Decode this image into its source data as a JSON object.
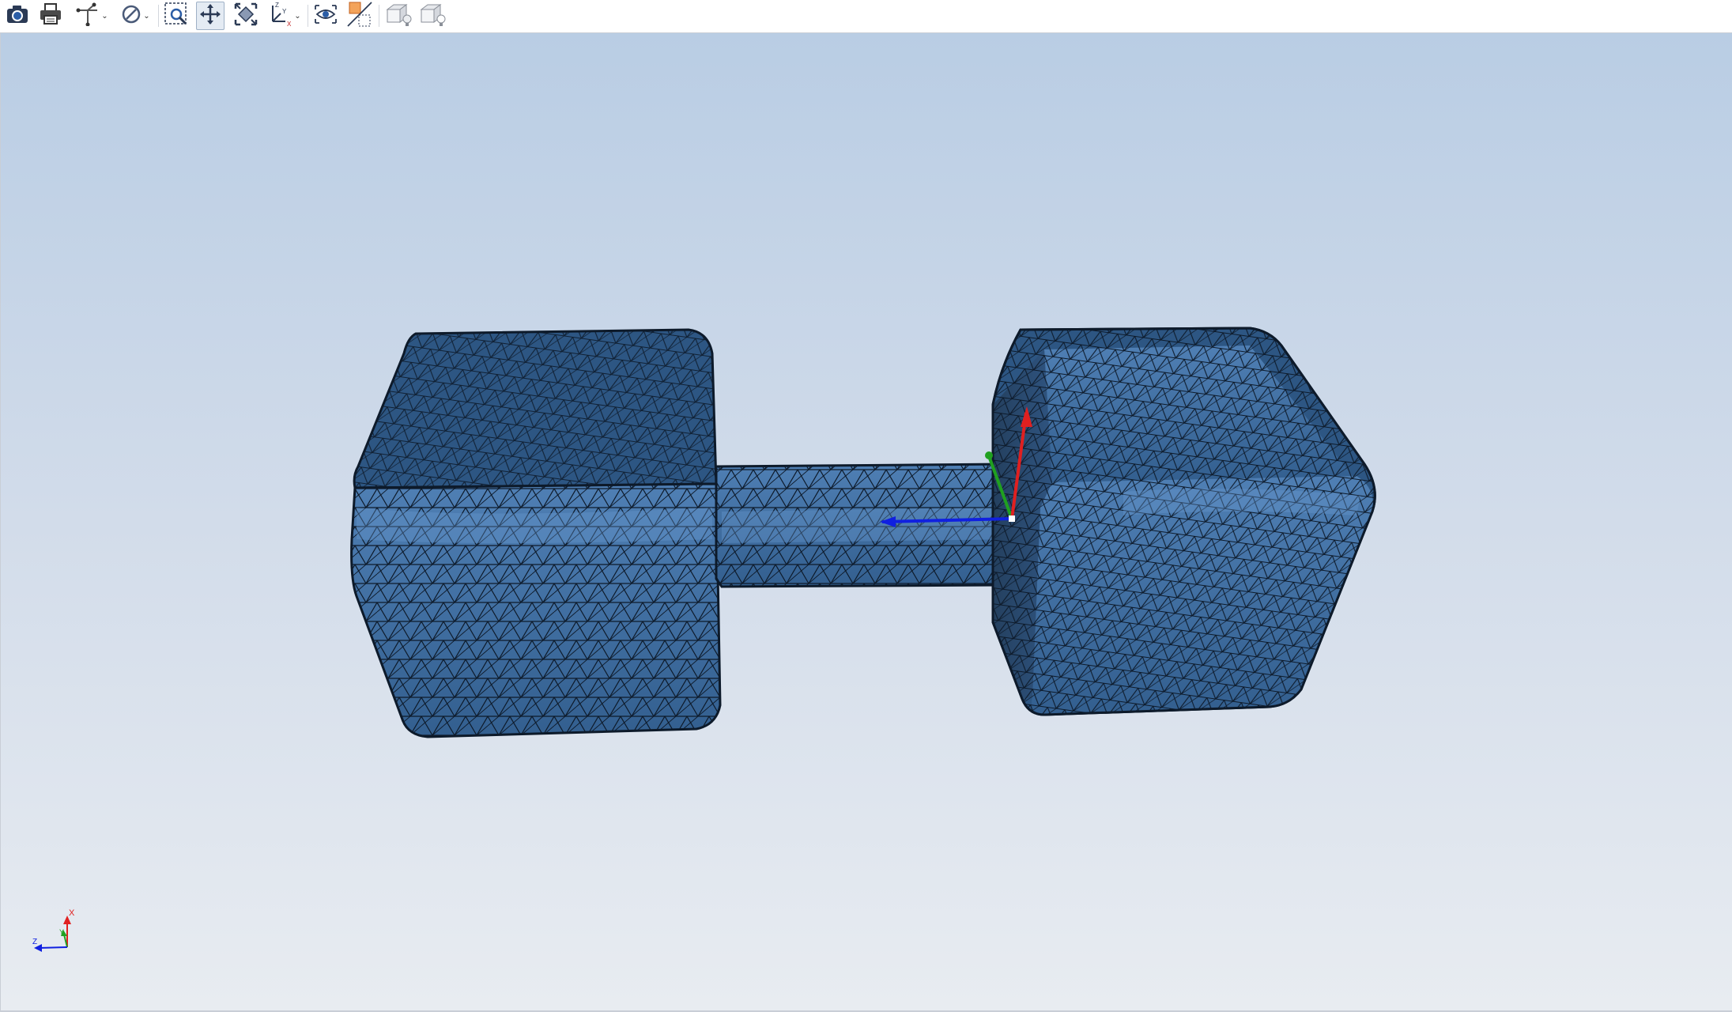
{
  "toolbar": {
    "buttons": [
      {
        "name": "screenshot-button",
        "icon": "camera-icon"
      },
      {
        "name": "print-button",
        "icon": "printer-icon"
      },
      {
        "name": "measure-dropdown",
        "icon": "measure-icon"
      },
      {
        "name": "display-mode-dropdown",
        "icon": "no-entry-icon"
      },
      {
        "name": "zoom-window-button",
        "icon": "zoom-window-icon"
      },
      {
        "name": "pan-button",
        "icon": "pan-icon",
        "active": true
      },
      {
        "name": "fit-all-button",
        "icon": "fit-all-icon"
      },
      {
        "name": "axis-view-dropdown",
        "icon": "axis-icon"
      },
      {
        "name": "view-button",
        "icon": "eye-icon"
      },
      {
        "name": "section-plane-button",
        "icon": "section-plane-icon"
      },
      {
        "name": "light-off-button",
        "icon": "box-light-icon"
      },
      {
        "name": "light-on-button",
        "icon": "box-light-icon"
      }
    ]
  },
  "viewport": {
    "background_top": "#b9cde4",
    "background_bottom": "#e8ecf1",
    "model_color": "#3c6a9b",
    "mesh_color": "#0d1a2a",
    "axis_labels": {
      "x": "X",
      "y": "Y",
      "z": "Z"
    },
    "axis_colors": {
      "x": "#e02020",
      "y": "#20a020",
      "z": "#1020e0"
    }
  }
}
